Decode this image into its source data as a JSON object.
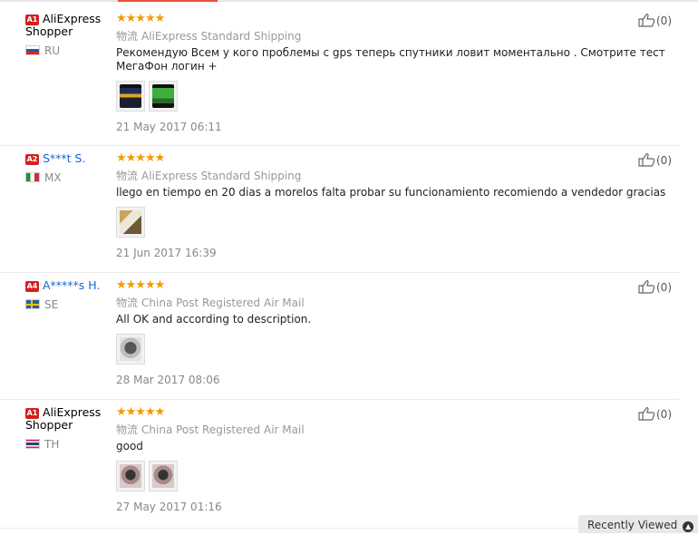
{
  "reviews": [
    {
      "level": "A1",
      "name": "AliExpress Shopper",
      "masked": false,
      "country": "RU",
      "flag": "flag-ru",
      "stars": "★★★★★",
      "shipping_label": "物流",
      "shipping": "AliExpress Standard Shipping",
      "text": "Рекомендую Всем у кого проблемы с gps теперь спутники ловит моментально . Смотрите тест МегаФон логин +",
      "photos": [
        "pic-phone1",
        "pic-phone2"
      ],
      "date": "21 May 2017 06:11",
      "likes": "(0)"
    },
    {
      "level": "A2",
      "name": "S***t S.",
      "masked": true,
      "country": "MX",
      "flag": "flag-mx",
      "stars": "★★★★★",
      "shipping_label": "物流",
      "shipping": "AliExpress Standard Shipping",
      "text": "llego en tiempo en 20 dias a morelos falta probar su funcionamiento recomiendo a vendedor gracias",
      "photos": [
        "pic-package"
      ],
      "date": "21 Jun 2017 16:39",
      "likes": "(0)"
    },
    {
      "level": "A4",
      "name": "A*****s H.",
      "masked": true,
      "country": "SE",
      "flag": "flag-se",
      "stars": "★★★★★",
      "shipping_label": "物流",
      "shipping": "China Post Registered Air Mail",
      "text": "All OK and according to description.",
      "photos": [
        "pic-device"
      ],
      "date": "28 Mar 2017 08:06",
      "likes": "(0)"
    },
    {
      "level": "A1",
      "name": "AliExpress Shopper",
      "masked": false,
      "country": "TH",
      "flag": "flag-th",
      "stars": "★★★★★",
      "shipping_label": "物流",
      "shipping": "China Post Registered Air Mail",
      "text": "good",
      "photos": [
        "pic-hand",
        "pic-hand"
      ],
      "date": "27 May 2017 01:16",
      "likes": "(0)"
    }
  ],
  "colors": {
    "accent": "#e8543b",
    "star": "#f29b00",
    "masked_name": "#1967d2",
    "level_badge": "#d4201d"
  },
  "recently_viewed": {
    "label": "Recently Viewed"
  }
}
